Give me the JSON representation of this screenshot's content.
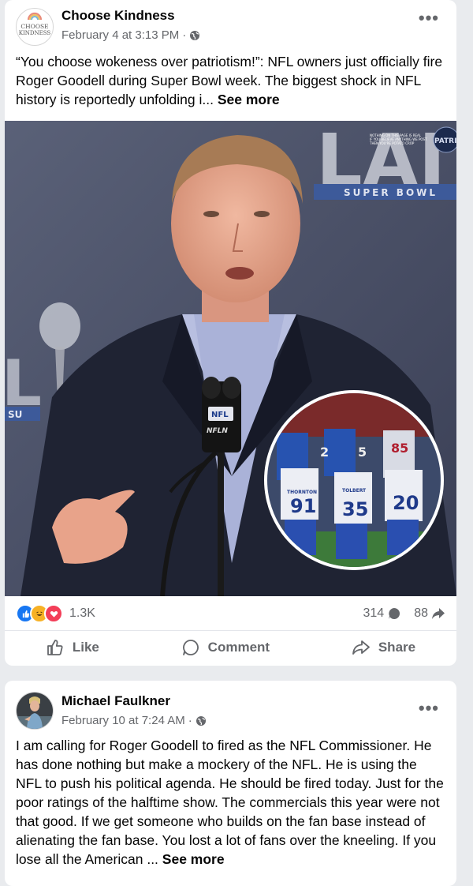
{
  "post1": {
    "author": "Choose Kindness",
    "timestamp": "February 4 at 3:13 PM",
    "privacy_icon": "globe-icon",
    "avatar_text_top": "CHOOSE",
    "avatar_text_bottom": "KINDNESS",
    "text": "“You choose wokeness over patriotism!”: NFL owners just officially fire Roger Goodell during Super Bowl week. The biggest shock in NFL history is reportedly unfolding i...",
    "see_more": "See more",
    "image": {
      "backdrop_text": "LAI",
      "banner_text": "SUPER BOWL",
      "left_letters": "L",
      "left_sub": "SU",
      "watermark_lines": [
        "NOTHING ON THIS PAGE IS REAL",
        "IF YOU BELIEVE ANYTHING WE POST",
        "THEN YOU'RE POTATO CROP"
      ],
      "watermark_badge": "PATRIOT",
      "mic_badge": "NFL",
      "mic_label": "NFLN",
      "inset_jerseys": [
        "91",
        "35",
        "20",
        "2",
        "5",
        "85"
      ],
      "inset_names": [
        "THORNTON",
        "TOLBERT"
      ]
    },
    "reaction_count": "1.3K",
    "comment_count": "314",
    "share_count": "88",
    "actions": {
      "like": "Like",
      "comment": "Comment",
      "share": "Share"
    }
  },
  "post2": {
    "author": "Michael Faulkner",
    "timestamp": "February 10 at 7:24 AM",
    "privacy_icon": "globe-icon",
    "text": "I am calling for Roger Goodell to fired as the NFL Commissioner. He has done nothing but make a mockery of the NFL. He is using the NFL to push his political agenda. He should be fired today. Just for the poor ratings of the halftime show. The commercials this year were not that good. If we get someone who builds on the fan base instead of alienating the fan base. You lost a lot of fans over the kneeling. If you lose all the American ...",
    "see_more": "See more"
  },
  "colors": {
    "like_blue": "#1877f2",
    "haha_yellow": "#f7b125",
    "love_red": "#f33e58",
    "secondary_text": "#65676b"
  }
}
